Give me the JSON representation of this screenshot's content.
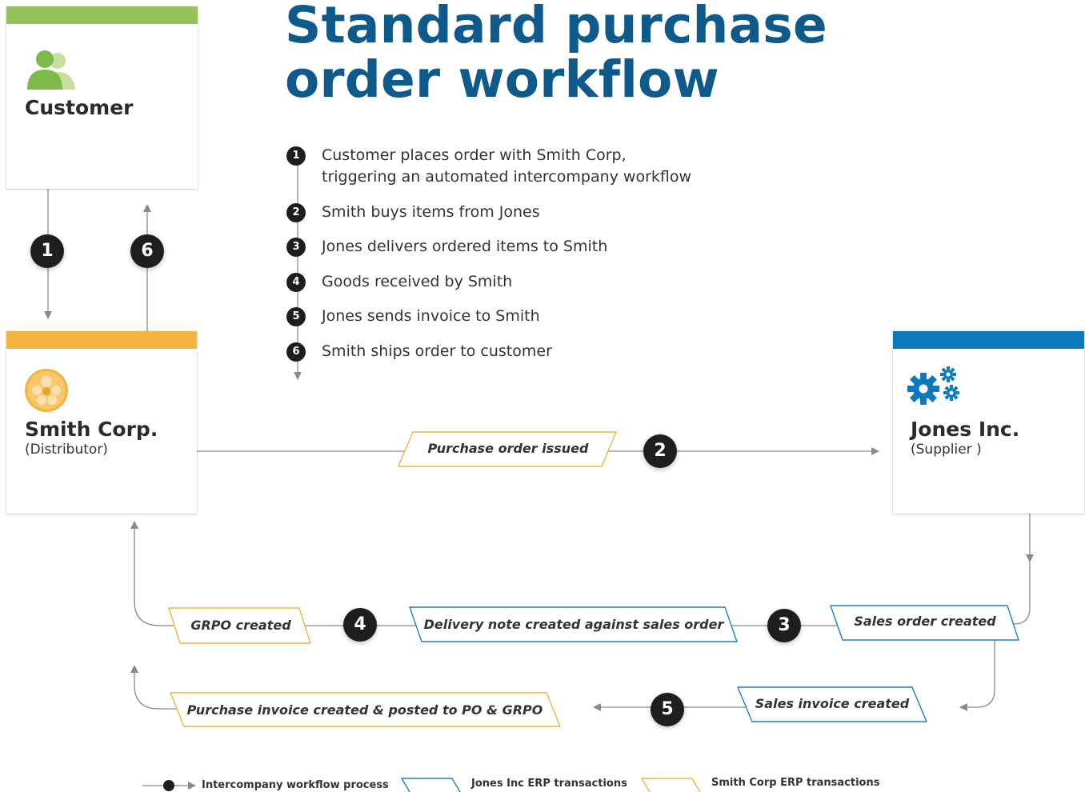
{
  "title": {
    "line1": "Standard purchase",
    "line2": "order workflow"
  },
  "entities": {
    "customer": {
      "name": "Customer",
      "icon": "people-icon",
      "color": "#93c35a"
    },
    "smith": {
      "name": "Smith Corp.",
      "role": "(Distributor)",
      "icon": "soccer-ball-icon",
      "color": "#f2b340"
    },
    "jones": {
      "name": "Jones Inc.",
      "role": "(Supplier )",
      "icon": "gears-icon",
      "color": "#0b79be"
    }
  },
  "steps": [
    {
      "num": "1",
      "text1": "Customer places order with Smith Corp,",
      "text2": "triggering an automated intercompany workflow"
    },
    {
      "num": "2",
      "text1": "Smith buys items from Jones"
    },
    {
      "num": "3",
      "text1": "Jones delivers ordered items to Smith"
    },
    {
      "num": "4",
      "text1": "Goods received by Smith"
    },
    {
      "num": "5",
      "text1": "Jones sends invoice to Smith"
    },
    {
      "num": "6",
      "text1": "Smith ships order to customer"
    }
  ],
  "badges": [
    "1",
    "6",
    "2",
    "4",
    "3",
    "5"
  ],
  "transactions": {
    "purchase_order": "Purchase order issued",
    "grpo": "GRPO created",
    "delivery_note": "Delivery note created against sales order",
    "sales_order": "Sales order created",
    "purchase_invoice": "Purchase invoice created & posted to PO & GRPO",
    "sales_invoice": "Sales invoice created"
  },
  "legend": {
    "process": "Intercompany workflow process",
    "jones": "Jones Inc ERP transactions",
    "smith": "Smith Corp ERP transactions"
  },
  "colors": {
    "title": "#0e5a8a",
    "smith_transaction": "#f2b340",
    "jones_transaction": "#1f7fc0",
    "badge": "#1e1e1e",
    "line": "#8a8a8a"
  }
}
